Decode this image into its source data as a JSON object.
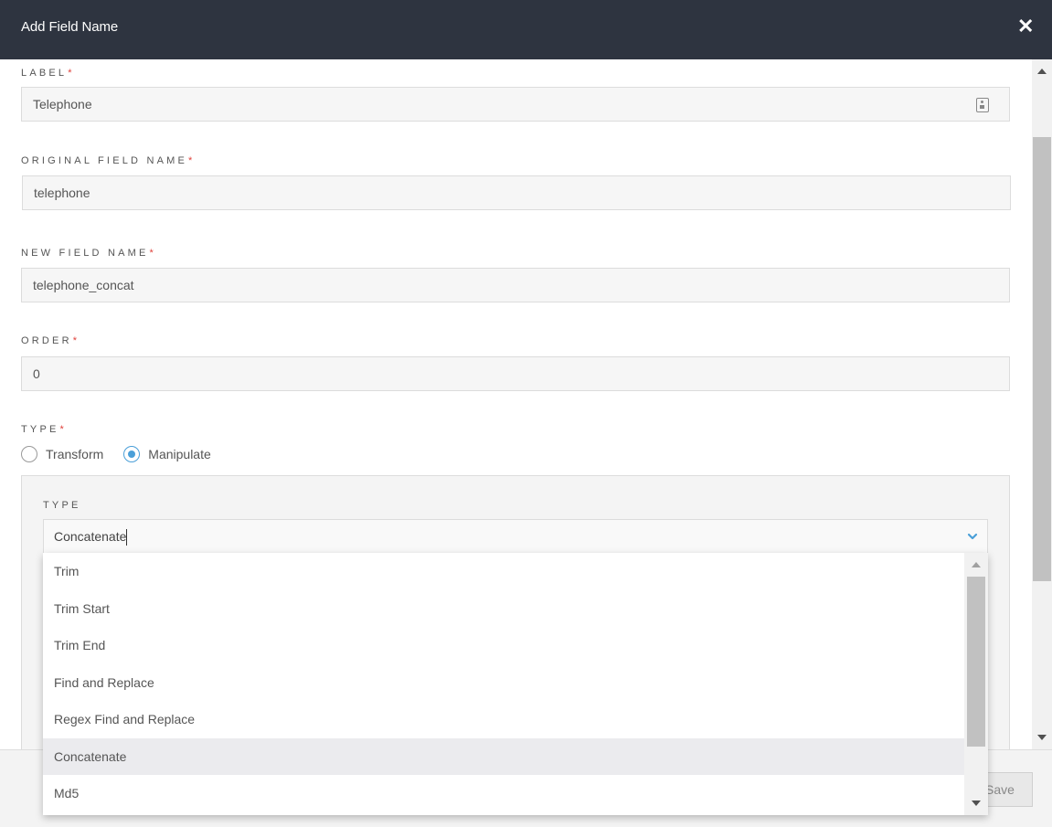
{
  "dialog": {
    "title": "Add Field Name",
    "close_icon": "close-icon",
    "required_marker": "*"
  },
  "form": {
    "label": {
      "label": "LABEL",
      "value": "Telephone",
      "icon": "contact-card-icon"
    },
    "original_field_name": {
      "label": "ORIGINAL FIELD NAME",
      "value": "telephone"
    },
    "new_field_name": {
      "label": "NEW FIELD NAME",
      "value": "telephone_concat"
    },
    "order": {
      "label": "ORDER",
      "value": "0"
    },
    "type": {
      "label": "TYPE",
      "options": [
        {
          "label": "Transform",
          "checked": false
        },
        {
          "label": "Manipulate",
          "checked": true
        }
      ]
    },
    "manipulate": {
      "type_label": "TYPE",
      "selected_value": "Concatenate",
      "dropdown_options": [
        "Trim",
        "Trim Start",
        "Trim End",
        "Find and Replace",
        "Regex Find and Replace",
        "Concatenate",
        "Md5"
      ],
      "highlighted_option": "Concatenate"
    }
  },
  "footer": {
    "save_label": "Save"
  },
  "colors": {
    "header_bg": "#2e3440",
    "required": "#e0413b",
    "accent": "#4a9fd8"
  }
}
